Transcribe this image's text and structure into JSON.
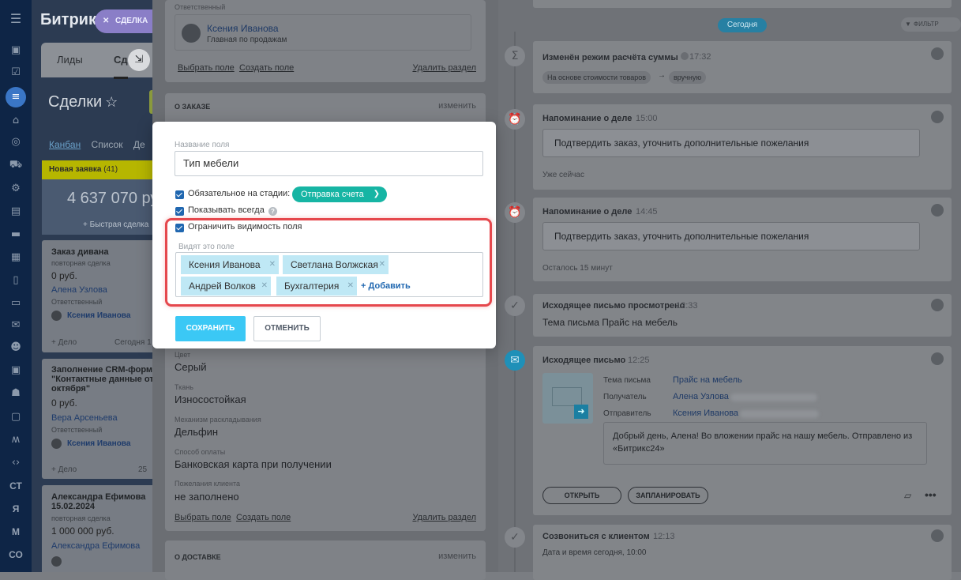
{
  "rail": {
    "labels": [
      "СТ",
      "Я",
      "М",
      "СО"
    ]
  },
  "kanban": {
    "brand": "Битрик",
    "deal_badge": "СДЕЛКА",
    "tab_leads": "Лиды",
    "tab_deals": "Сд",
    "title": "Сделки",
    "views": [
      "Канбан",
      "Список",
      "Де"
    ],
    "column_title": "Новая заявка",
    "column_count": "(41)",
    "column_sum": "4 637 070 ру",
    "quick_deal": "Быстрая сделка",
    "cards": [
      {
        "title": "Заказ дивана",
        "sub": "повторная сделка",
        "sum": "0 руб.",
        "contact": "Алена Узлова",
        "resp_label": "Ответственный",
        "resp": "Ксения Иванова",
        "footer_left": "+ Дело",
        "footer_right": "Сегодня 1"
      },
      {
        "title": "Заполнение CRM-формы \"Контактные данные от 24 октября\"",
        "sum": "0 руб.",
        "contact": "Вера Арсеньева",
        "resp_label": "Ответственный",
        "resp": "Ксения Иванова",
        "footer_left": "+ Дело",
        "footer_right": "25 "
      },
      {
        "title": "Александра Ефимова 15.02.2024",
        "sub": "повторная сделка",
        "sum": "1 000 000 руб.",
        "contact": "Александра Ефимова"
      }
    ]
  },
  "form": {
    "responsible_label": "Ответственный",
    "responsible_name": "Ксения Иванова",
    "responsible_role": "Главная по продажам",
    "select_field": "Выбрать поле",
    "create_field": "Создать поле",
    "delete_section": "Удалить раздел",
    "order_section": "О ЗАКАЗЕ",
    "change": "изменить",
    "fields": [
      {
        "label": "Цвет",
        "value": "Серый"
      },
      {
        "label": "Ткань",
        "value": "Износостойкая"
      },
      {
        "label": "Механизм раскладывания",
        "value": "Дельфин"
      },
      {
        "label": "Способ оплаты",
        "value": "Банковская карта при получении"
      },
      {
        "label": "Пожелания клиента",
        "value": "не заполнено"
      }
    ],
    "delivery_section": "О ДОСТАВКЕ"
  },
  "modal": {
    "field_name_label": "Название поля",
    "field_name_value": "Тип мебели",
    "required_label": "Обязательное на стадии:",
    "stage_value": "Отправка счета",
    "show_always_label": "Показывать всегда",
    "restrict_label": "Ограничить видимость поля",
    "sees_label": "Видят это поле",
    "tags": [
      "Ксения Иванова",
      "Светлана Волжская",
      "Андрей Волков",
      "Бухгалтерия"
    ],
    "add_label": "Добавить",
    "save": "СОХРАНИТЬ",
    "cancel": "ОТМЕНИТЬ"
  },
  "timeline": {
    "today": "Сегодня",
    "filter": "ФИЛЬТР",
    "items": [
      {
        "title": "Изменён режим расчёта суммы",
        "time": "17:32",
        "pill_from": "На основе стоимости товаров",
        "pill_to": "вручную"
      },
      {
        "title": "Напоминание о деле",
        "time": "15:00",
        "text": "Подтвердить заказ, уточнить дополнительные пожелания",
        "note": "Уже сейчас"
      },
      {
        "title": "Напоминание о деле",
        "time": "14:45",
        "text": "Подтвердить заказ, уточнить дополнительные пожелания",
        "note": "Осталось 15 минут"
      },
      {
        "title": "Исходящее письмо просмотрено",
        "time": "12:33",
        "text": "Тема письма Прайс на мебель"
      },
      {
        "title": "Исходящее письмо",
        "time": "12:25",
        "subject_label": "Тема письма",
        "subject": "Прайс на мебель",
        "to_label": "Получатель",
        "to": "Алена Узлова",
        "from_label": "Отправитель",
        "from": "Ксения Иванова",
        "body": "Добрый день, Алена! Во вложении прайс на нашу мебель.  Отправлено из «Битрикс24»",
        "open": "ОТКРЫТЬ",
        "plan": "ЗАПЛАНИРОВАТЬ"
      },
      {
        "title": "Созвониться с клиентом",
        "time": "12:13",
        "text": "Дата и время сегодня, 10:00"
      }
    ]
  }
}
